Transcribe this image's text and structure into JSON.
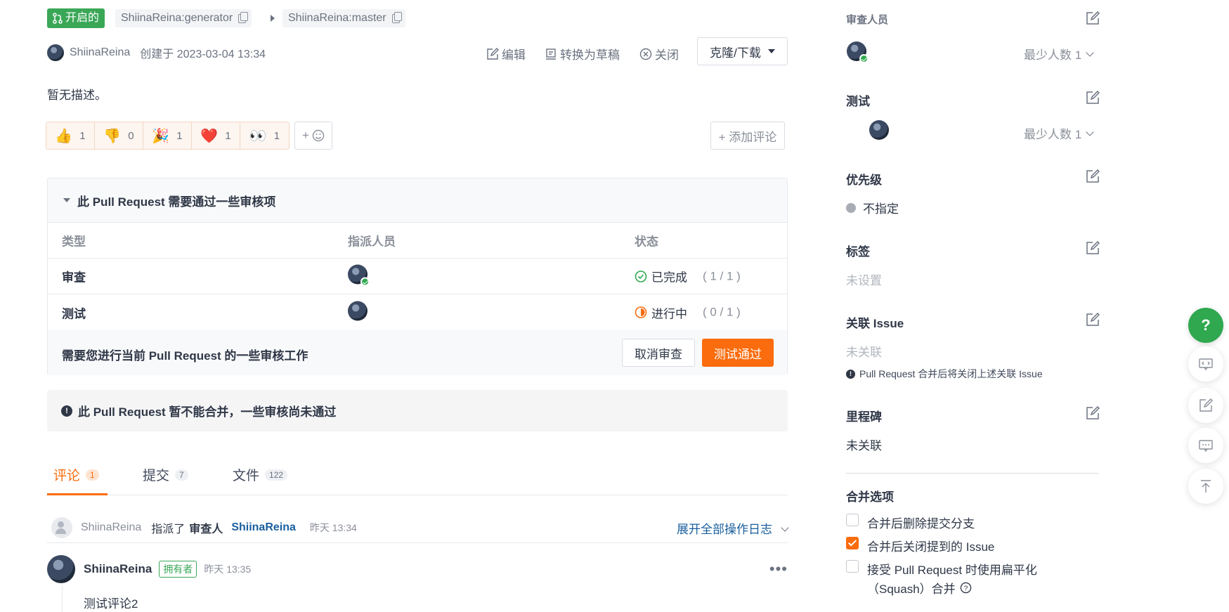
{
  "header": {
    "status_badge": "开启的",
    "source_branch": "ShiinaReina:generator",
    "target_branch": "ShiinaReina:master",
    "author": "ShiinaReina",
    "created": "创建于 2023-03-04 13:34",
    "actions": {
      "edit": "编辑",
      "to_draft": "转换为草稿",
      "close": "关闭",
      "clone": "克隆/下载"
    }
  },
  "description": "暂无描述。",
  "reactions": [
    {
      "emoji": "👍",
      "count": "1",
      "name": "thumbs-up"
    },
    {
      "emoji": "👎",
      "count": "0",
      "name": "thumbs-down"
    },
    {
      "emoji": "🎉",
      "count": "1",
      "name": "party"
    },
    {
      "emoji": "❤️",
      "count": "1",
      "name": "heart"
    },
    {
      "emoji": "👀",
      "count": "1",
      "name": "eyes"
    }
  ],
  "add_emoji": "+",
  "add_comment": "+ 添加评论",
  "review": {
    "title": "此 Pull Request 需要通过一些审核项",
    "columns": [
      "类型",
      "指派人员",
      "状态"
    ],
    "rows": [
      {
        "type": "审查",
        "status": "已完成",
        "count": "( 1 / 1 )"
      },
      {
        "type": "测试",
        "status": "进行中",
        "count": "( 0 / 1 )"
      }
    ],
    "footer_text": "需要您进行当前 Pull Request 的一些审核工作",
    "cancel_btn": "取消审查",
    "pass_btn": "测试通过"
  },
  "merge_warning": "此 Pull Request 暂不能合并，一些审核尚未通过",
  "tabs": [
    {
      "label": "评论",
      "count": "1"
    },
    {
      "label": "提交",
      "count": "7"
    },
    {
      "label": "文件",
      "count": "122"
    }
  ],
  "log": {
    "user": "ShiinaReina",
    "action": "指派了",
    "role": "审查人",
    "target": "ShiinaReina",
    "time": "昨天 13:34",
    "expand": "展开全部操作日志"
  },
  "comment": {
    "author": "ShiinaReina",
    "badge": "拥有者",
    "time": "昨天 13:35",
    "more": "•••",
    "body": "测试评论2"
  },
  "sidebar": {
    "reviewers_label": "审查人员",
    "reviewers_min": "最少人数 1",
    "testers_label": "测试",
    "testers_min": "最少人数 1",
    "priority_label": "优先级",
    "priority_value": "不指定",
    "tags_label": "标签",
    "tags_value": "未设置",
    "issue_label": "关联 Issue",
    "issue_value": "未关联",
    "issue_note": "Pull Request 合并后将关闭上述关联 Issue",
    "milestone_label": "里程碑",
    "milestone_value": "未关联",
    "merge_label": "合并选项",
    "opt_delete_branch": "合并后删除提交分支",
    "opt_close_issue": "合并后关闭提到的 Issue",
    "opt_squash_1": "接受 Pull Request 时使用扁平化",
    "opt_squash_2": "（Squash）合并"
  },
  "float": {
    "help": "?"
  },
  "colors": {
    "accent": "#fa6c0d",
    "success": "#2fa84f",
    "link": "#1a5f9e"
  }
}
